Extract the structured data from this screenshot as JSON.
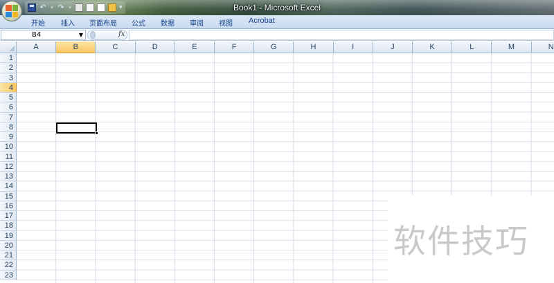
{
  "window": {
    "title": "Book1 - Microsoft Excel"
  },
  "quick_access": {
    "icons": [
      "office-button-icon",
      "save-icon",
      "undo-icon",
      "redo-icon",
      "print-icon",
      "print-preview-icon",
      "new-document-icon",
      "open-folder-icon",
      "customize-icon"
    ]
  },
  "ribbon": {
    "tabs": [
      {
        "label": "开始"
      },
      {
        "label": "插入"
      },
      {
        "label": "页面布局"
      },
      {
        "label": "公式"
      },
      {
        "label": "数据"
      },
      {
        "label": "审阅"
      },
      {
        "label": "视图"
      },
      {
        "label": "Acrobat"
      }
    ]
  },
  "formula_bar": {
    "name_box": "B4",
    "fx_label": "fx",
    "formula": ""
  },
  "sheet": {
    "columns": [
      "A",
      "B",
      "C",
      "D",
      "E",
      "F",
      "G",
      "H",
      "I",
      "J",
      "K",
      "L",
      "M",
      "N"
    ],
    "rows": [
      "1",
      "2",
      "3",
      "4",
      "5",
      "6",
      "7",
      "8",
      "9",
      "10",
      "11",
      "12",
      "13",
      "14",
      "15",
      "16",
      "17",
      "18",
      "19",
      "20",
      "21",
      "22",
      "23"
    ],
    "active_cell": "B4",
    "selected_column": "B",
    "selected_row": "4"
  },
  "watermark": {
    "text": "软件技巧"
  },
  "colors": {
    "selection_header": "#f8c65f",
    "ribbon_text": "#15428b",
    "grid_line": "#d4dde8"
  }
}
